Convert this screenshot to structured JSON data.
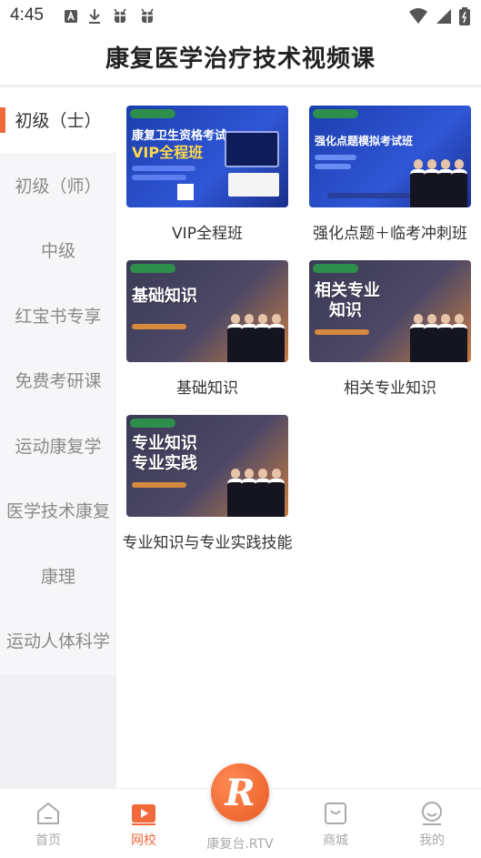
{
  "status": {
    "time": "4:45"
  },
  "header": {
    "title": "康复医学治疗技术视频课"
  },
  "sidebar": {
    "items": [
      {
        "label": "初级（士）",
        "active": true
      },
      {
        "label": "初级（师）"
      },
      {
        "label": "中级"
      },
      {
        "label": "红宝书专享"
      },
      {
        "label": "免费考研课"
      },
      {
        "label": "运动康复学"
      },
      {
        "label": "医学技术康复"
      },
      {
        "label": "康理"
      },
      {
        "label": "运动人体科学"
      }
    ]
  },
  "courses": [
    {
      "title": "VIP全程班",
      "thumb_text_1": "康复卫生资格考试",
      "thumb_text_2": "VIP全程班"
    },
    {
      "title": "强化点题＋临考冲刺班",
      "thumb_text_1": "强化点题模拟考试班"
    },
    {
      "title": "基础知识",
      "thumb_text_1": "基础知识"
    },
    {
      "title": "相关专业知识",
      "thumb_text_1": "相关专业",
      "thumb_text_2": "知识"
    },
    {
      "title": "专业知识与专业实践技能",
      "thumb_text_1": "专业知识",
      "thumb_text_2": "专业实践"
    }
  ],
  "tabbar": {
    "items": [
      {
        "label": "首页",
        "icon": "home-icon"
      },
      {
        "label": "网校",
        "icon": "video-icon",
        "active": true
      },
      {
        "label": "康复台.RTV",
        "icon": "logo-badge-icon"
      },
      {
        "label": "商城",
        "icon": "shop-icon"
      },
      {
        "label": "我的",
        "icon": "profile-icon"
      }
    ]
  },
  "colors": {
    "accent": "#f06a3c",
    "sidebar_bg": "#f6f6f8",
    "text": "#333333",
    "muted": "#8a8a8a"
  }
}
